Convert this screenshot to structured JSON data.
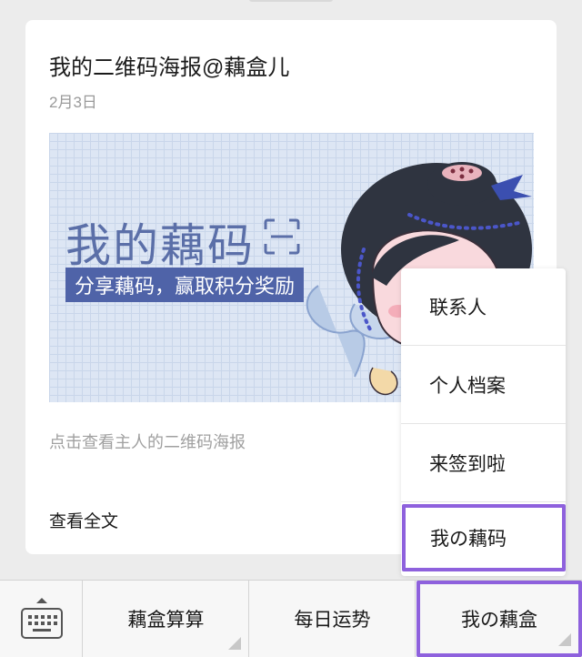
{
  "article": {
    "title": "我的二维码海报@藕盒儿",
    "date": "2月3日",
    "cover": {
      "title": "我的藕码",
      "subtitle": "分享藕码，赢取积分奖励",
      "qr_icon": "qr-code-scan-icon"
    },
    "description": "点击查看主人的二维码海报",
    "read_more": "查看全文"
  },
  "popup_menu": {
    "items": [
      {
        "label": "联系人"
      },
      {
        "label": "个人档案"
      },
      {
        "label": "来签到啦"
      },
      {
        "label": "我の藕码"
      }
    ],
    "highlighted_index": 3
  },
  "bottom_menu": {
    "keyboard_icon": "keyboard-icon",
    "tabs": [
      {
        "label": "藕盒算算"
      },
      {
        "label": "每日运势"
      },
      {
        "label": "我の藕盒"
      }
    ],
    "highlighted_index": 2
  },
  "colors": {
    "highlight_border": "#8e61dd",
    "cover_accent": "#4f63a8",
    "cover_background": "#dde6f4"
  }
}
